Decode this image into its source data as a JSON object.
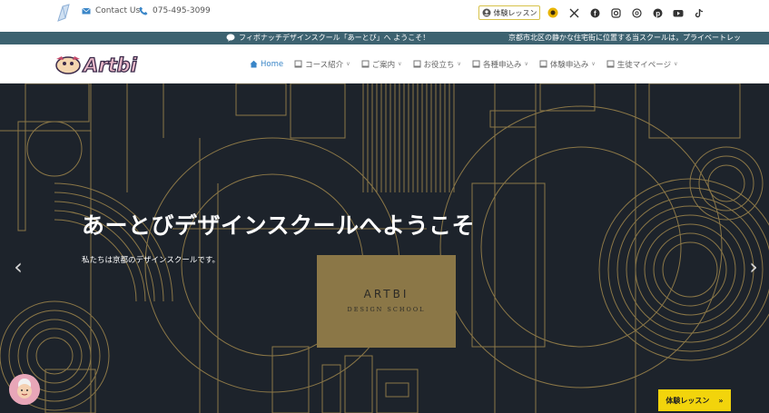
{
  "topbar": {
    "contact_label": "Contact Us",
    "phone": "075-495-3099",
    "trial_button": "体験レッスン",
    "social_icons": [
      "sunflower-icon",
      "x-icon",
      "facebook-icon",
      "instagram-icon",
      "threads-icon",
      "pinterest-icon",
      "youtube-icon",
      "tiktok-icon"
    ]
  },
  "ticker": {
    "message_1": "フィボナッチデザインスクール「あーとび」へ ようこそ！",
    "message_2": "京都市北区の静かな住宅街に位置する当スクールは，プライベートレッ"
  },
  "nav": {
    "brand": "Artbi",
    "items": [
      {
        "label": "Home",
        "active": true,
        "dropdown": false
      },
      {
        "label": "コース紹介",
        "active": false,
        "dropdown": true
      },
      {
        "label": "ご案内",
        "active": false,
        "dropdown": true
      },
      {
        "label": "お役立ち",
        "active": false,
        "dropdown": true
      },
      {
        "label": "各種申込み",
        "active": false,
        "dropdown": true
      },
      {
        "label": "体験申込み",
        "active": false,
        "dropdown": true
      },
      {
        "label": "生徒マイページ",
        "active": false,
        "dropdown": true
      }
    ]
  },
  "hero": {
    "title": "あーとびデザインスクールへようこそ",
    "subtitle": "私たちは京都のデザインスクールです。",
    "box_title": "ARTBI",
    "box_subtitle": "DESIGN SCHOOL",
    "prev_arrow": "‹",
    "next_arrow": "›"
  },
  "floating": {
    "trial_button": "体験レッスン",
    "trial_arrow": "»"
  },
  "colors": {
    "ticker_bg": "#3d6270",
    "hero_bg": "#1d232b",
    "line_gold": "#8b7747",
    "accent_yellow": "#f2d40c",
    "nav_active": "#3a86c8"
  }
}
